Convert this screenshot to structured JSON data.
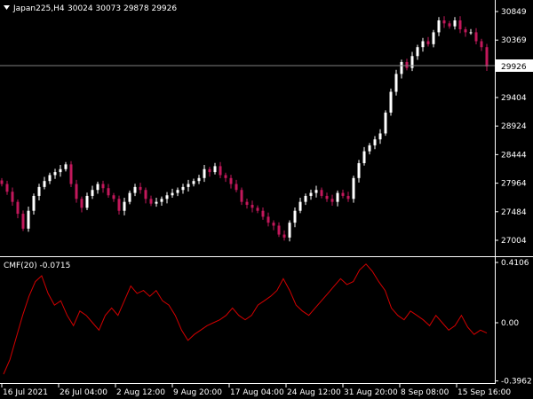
{
  "window": {
    "symbol_label": "Japan225,H4",
    "ohlc_label": "30024 30073 29878 29926"
  },
  "price_panel": {
    "current_price_label": "29926"
  },
  "indicator_panel": {
    "label": "CMF(20) -0.0715"
  },
  "colors": {
    "background": "#000000",
    "bull_candle": "#ffffff",
    "bear_candle": "#c2185b",
    "cmf_line": "#d40000",
    "axis": "#ffffff",
    "grid_line": "#808080"
  },
  "icons": {
    "window_menu": "triangle-down-icon"
  },
  "chart_data": [
    {
      "type": "candlestick",
      "y_axis_labels": [
        "30849",
        "30369",
        "29926",
        "29404",
        "28924",
        "28444",
        "27964",
        "27484",
        "27004"
      ],
      "ylim": [
        26950,
        31000
      ],
      "current_price": 29926,
      "x_axis_labels": [
        "16 Jul 2021",
        "26 Jul 04:00",
        "2 Aug 12:00",
        "9 Aug 20:00",
        "17 Aug 04:00",
        "24 Aug 12:00",
        "31 Aug 20:00",
        "8 Sep 08:00",
        "15 Sep 16:00"
      ],
      "series_closes": [
        27950,
        27820,
        27650,
        27450,
        27200,
        27500,
        27750,
        27900,
        28000,
        28100,
        28150,
        28200,
        28280,
        27950,
        27700,
        27550,
        27750,
        27850,
        27950,
        27880,
        27760,
        27700,
        27500,
        27650,
        27800,
        27900,
        27850,
        27700,
        27620,
        27650,
        27700,
        27760,
        27800,
        27850,
        27900,
        27950,
        28000,
        28050,
        28200,
        28150,
        28250,
        28100,
        28050,
        27950,
        27850,
        27650,
        27600,
        27550,
        27500,
        27400,
        27300,
        27250,
        27100,
        27050,
        27300,
        27500,
        27650,
        27750,
        27800,
        27850,
        27750,
        27700,
        27650,
        27800,
        27750,
        27700,
        28050,
        28300,
        28500,
        28600,
        28700,
        28800,
        29150,
        29500,
        29800,
        30000,
        29900,
        30100,
        30250,
        30350,
        30300,
        30500,
        30700,
        30650,
        30600,
        30700,
        30550,
        30500,
        30500,
        30350,
        30250,
        29926
      ]
    },
    {
      "type": "line",
      "y_axis_labels": [
        "0.4106",
        "0.00",
        "-0.3962"
      ],
      "ylim": [
        -0.44,
        0.44
      ],
      "current_value": -0.0715,
      "values": [
        -0.35,
        -0.25,
        -0.1,
        0.05,
        0.18,
        0.28,
        0.32,
        0.2,
        0.12,
        0.15,
        0.05,
        -0.02,
        0.08,
        0.05,
        0.0,
        -0.05,
        0.05,
        0.1,
        0.05,
        0.15,
        0.25,
        0.2,
        0.22,
        0.18,
        0.22,
        0.15,
        0.12,
        0.05,
        -0.05,
        -0.12,
        -0.08,
        -0.05,
        -0.02,
        0.0,
        0.02,
        0.05,
        0.1,
        0.05,
        0.02,
        0.05,
        0.12,
        0.15,
        0.18,
        0.22,
        0.3,
        0.22,
        0.12,
        0.08,
        0.05,
        0.1,
        0.15,
        0.2,
        0.25,
        0.3,
        0.26,
        0.28,
        0.36,
        0.4,
        0.35,
        0.28,
        0.22,
        0.1,
        0.05,
        0.02,
        0.08,
        0.05,
        0.02,
        -0.02,
        0.05,
        0.0,
        -0.05,
        -0.02,
        0.05,
        -0.03,
        -0.08,
        -0.05,
        -0.07
      ]
    }
  ]
}
